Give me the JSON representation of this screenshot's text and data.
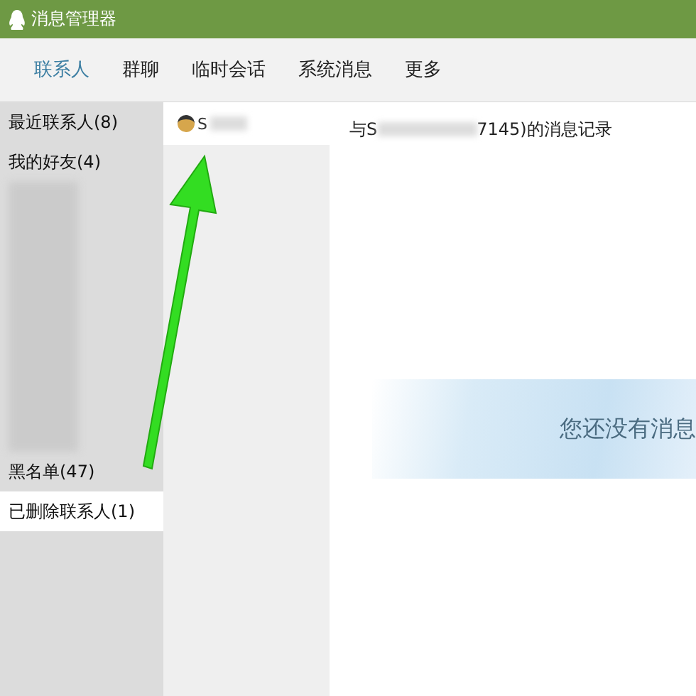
{
  "window": {
    "title": "消息管理器"
  },
  "tabs": [
    {
      "label": "联系人",
      "selected": true
    },
    {
      "label": "群聊",
      "selected": false
    },
    {
      "label": "临时会话",
      "selected": false
    },
    {
      "label": "系统消息",
      "selected": false
    },
    {
      "label": "更多",
      "selected": false
    }
  ],
  "groups": [
    {
      "kind": "text",
      "label": "最近联系人(8)",
      "selected": false
    },
    {
      "kind": "text",
      "label": "我的好友(4)",
      "selected": false
    },
    {
      "kind": "redacted",
      "selected": false
    },
    {
      "kind": "text",
      "label": "黑名单(47)",
      "selected": false
    },
    {
      "kind": "text",
      "label": "已删除联系人(1)",
      "selected": true
    }
  ],
  "contacts": [
    {
      "name": "S",
      "selected": true
    }
  ],
  "record": {
    "title_start": "与S",
    "title_end": "7145)的消息记录",
    "empty_text": "您还没有消息"
  },
  "annotation": {
    "kind": "arrow"
  }
}
